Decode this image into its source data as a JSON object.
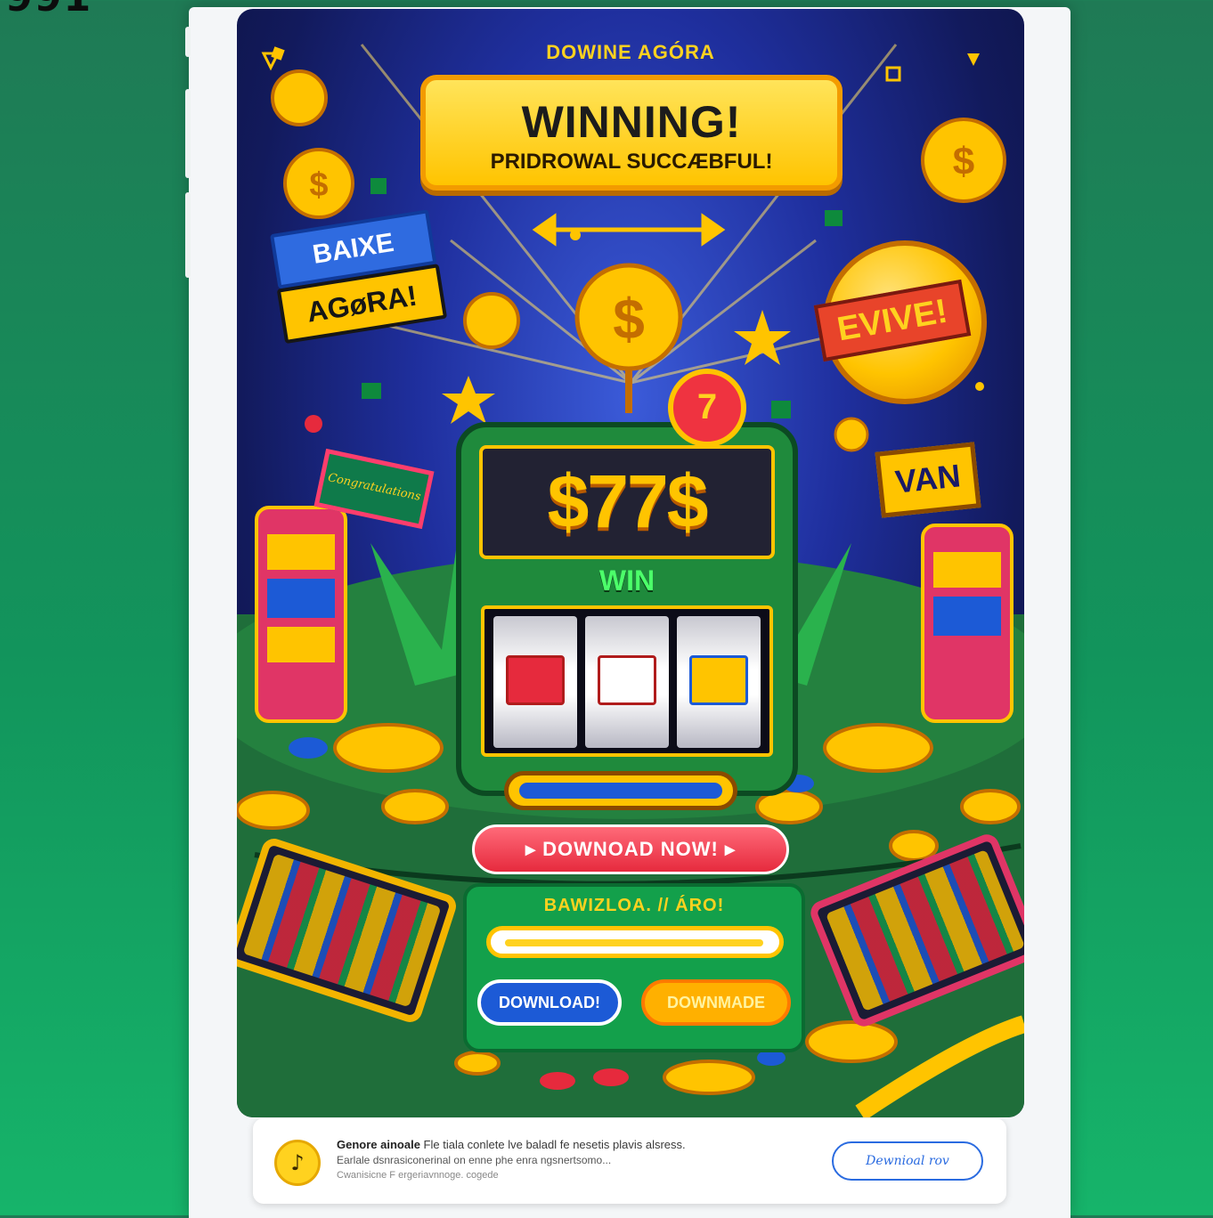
{
  "corner_text": "991",
  "poster": {
    "top_label": "DOWINE AGÓRA",
    "banner_title": "WINNING!",
    "banner_subtitle": "PRIDROWAL SUCCÆBFUL!",
    "baixe_top": "BAIXE",
    "baixe_bottom": "AGøRA!",
    "evive_sign": "EVIVE!",
    "van_sign": "VAN",
    "congrats_sign": "Congratulations",
    "seven_pin": "7",
    "slot_screen": "$77$",
    "win_label": "WIN",
    "download_now": "▸  DOWNOAD NOW!  ▸",
    "panel_title": "BAWIZLOA. // ÁRO!",
    "btn_blue": "DOWNLOAD!",
    "btn_orange": "DOWNMADE"
  },
  "notification": {
    "icon": "♪",
    "title_bold": "Genore ainoale",
    "title_rest": "Fle tiala conlete lve baladl fe nesetis plavis alsress.",
    "line2": "Earlale dsnrasiconerinal on enne phe enra ngsnertsomo...",
    "line3": "Cwanisicne  F   ergeriavnnoge.    cogede",
    "button": "Dewnioal rov"
  },
  "colors": {
    "background_green": "#12955c",
    "poster_blue": "#1f2f9e",
    "gold": "#ffc400",
    "red": "#e62a3d",
    "link_blue": "#2a6be0"
  }
}
